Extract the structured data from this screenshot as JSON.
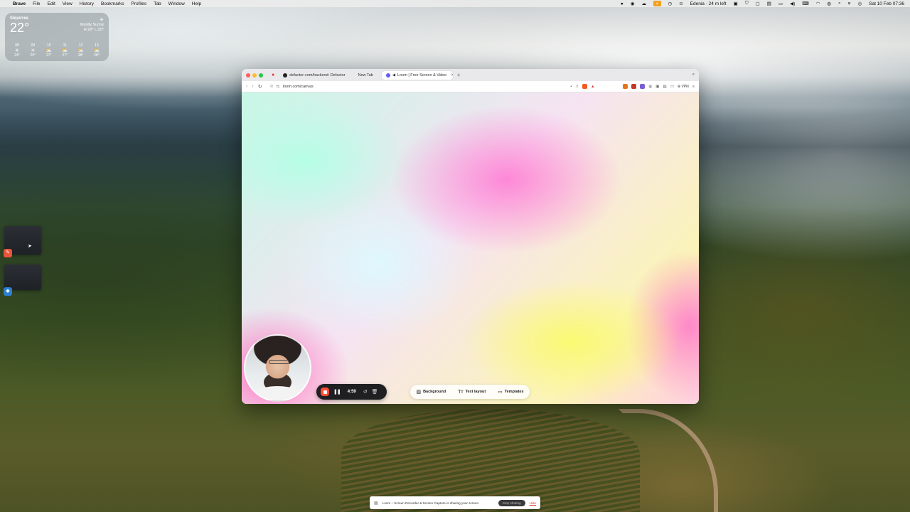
{
  "menubar": {
    "app_name": "Brave",
    "menus": [
      "File",
      "Edit",
      "View",
      "History",
      "Bookmarks",
      "Profiles",
      "Tab",
      "Window",
      "Help"
    ],
    "battery_label": "Edenia · 24 m left",
    "datetime": "Sat 10 Feb  07:36"
  },
  "weather": {
    "city": "Siquirres",
    "temp": "22°",
    "condition": "Mostly Sunny",
    "hilo": "H:28° L:20°",
    "hours": [
      {
        "time": "08",
        "icon": "sun-icon",
        "temp": "24°"
      },
      {
        "time": "09",
        "icon": "sun-icon",
        "temp": "25°"
      },
      {
        "time": "10",
        "icon": "partly-cloudy-icon",
        "temp": "27°"
      },
      {
        "time": "11",
        "icon": "partly-cloudy-icon",
        "temp": "27°"
      },
      {
        "time": "12",
        "icon": "partly-cloudy-icon",
        "temp": "28°"
      },
      {
        "time": "13",
        "icon": "partly-cloudy-icon",
        "temp": "28°"
      }
    ]
  },
  "browser": {
    "tabs": [
      {
        "title": "defactor-com/backend: Defactor",
        "active": false
      },
      {
        "title": "New Tab",
        "active": false
      },
      {
        "title": "Loom | Free Screen & Video",
        "active": true
      }
    ],
    "url": "loom.com/canvas",
    "vpn_label": "VPN"
  },
  "recording": {
    "timer": "4:59"
  },
  "canvas_tools": {
    "background": "Background",
    "text_layout": "Text layout",
    "templates": "Templates"
  },
  "share_bar": {
    "message": "Loom – Screen Recorder & Screen Capture is sharing your screen.",
    "stop_label": "Stop sharing",
    "hide_label": "Hide"
  },
  "colors": {
    "stop_red": "#ff4d3d",
    "controls_bg": "#1f1f22"
  }
}
